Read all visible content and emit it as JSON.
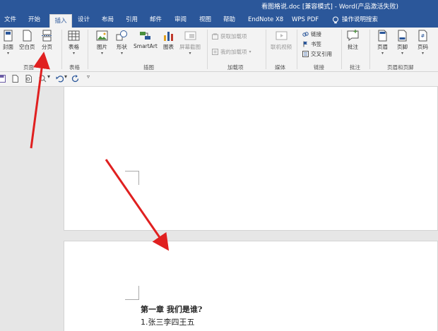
{
  "window": {
    "title": "看图格说.doc [兼容模式] - Word(产品激活失败)"
  },
  "tabs": [
    {
      "label": "文件"
    },
    {
      "label": "开始"
    },
    {
      "label": "插入"
    },
    {
      "label": "设计"
    },
    {
      "label": "布局"
    },
    {
      "label": "引用"
    },
    {
      "label": "邮件"
    },
    {
      "label": "审阅"
    },
    {
      "label": "视图"
    },
    {
      "label": "帮助"
    },
    {
      "label": "EndNote X8"
    },
    {
      "label": "WPS PDF"
    },
    {
      "label": "操作说明搜索"
    }
  ],
  "ribbon": {
    "pages": {
      "cover": "封面",
      "blank_page": "空白页",
      "page_break": "分页",
      "group": "页面"
    },
    "tables": {
      "table": "表格",
      "group": "表格"
    },
    "illustrations": {
      "pictures": "图片",
      "shapes": "形状",
      "smartart": "SmartArt",
      "chart": "图表",
      "screenshot": "屏幕截图",
      "group": "插图"
    },
    "addins": {
      "get_addins": "获取加载项",
      "my_addins": "我的加载项",
      "group": "加载项"
    },
    "media": {
      "online_video": "联机视频",
      "group": "媒体"
    },
    "links": {
      "link": "链接",
      "bookmark": "书签",
      "cross_ref": "交叉引用",
      "group": "链接"
    },
    "comments": {
      "comment": "批注",
      "group": "批注"
    },
    "header_footer": {
      "header": "页眉",
      "footer": "页脚",
      "page_number": "页码",
      "group": "页眉和页脚"
    }
  },
  "document": {
    "heading": "第一章 我们是谁?",
    "line1": "1.张三李四王五"
  },
  "colors": {
    "accent": "#2b579a",
    "arrow": "#e02020"
  }
}
